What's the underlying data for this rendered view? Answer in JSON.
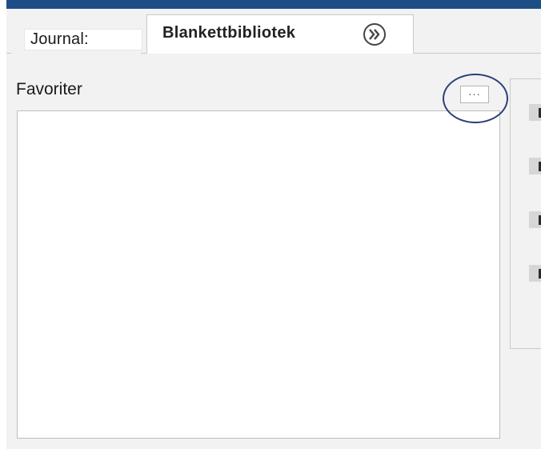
{
  "tabs": [
    {
      "label": "Journal:",
      "active": false
    },
    {
      "label": "Blankettbibliotek",
      "active": true
    }
  ],
  "tab_more_icon": "double-chevron-right-icon",
  "favorites": {
    "label": "Favoriter",
    "more_button_label": "...",
    "items": []
  },
  "colors": {
    "accent_bar": "#1e4e86",
    "highlight_ring": "#2b3f7a"
  }
}
